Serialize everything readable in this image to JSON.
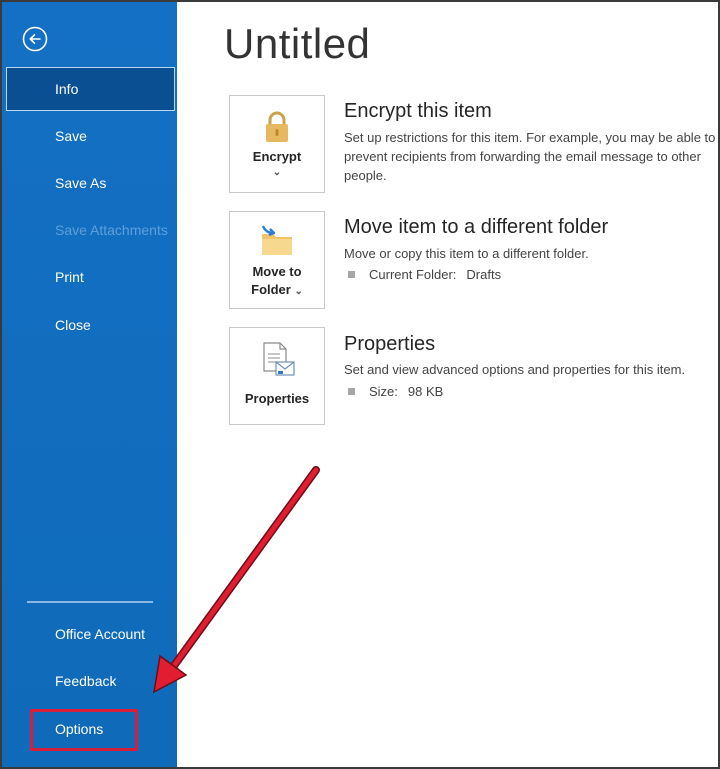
{
  "nav": {
    "items": [
      {
        "label": "Info"
      },
      {
        "label": "Save"
      },
      {
        "label": "Save As"
      },
      {
        "label": "Save Attachments"
      },
      {
        "label": "Print"
      },
      {
        "label": "Close"
      }
    ],
    "bottom_items": [
      {
        "label": "Office Account"
      },
      {
        "label": "Feedback"
      },
      {
        "label": "Options"
      }
    ]
  },
  "page": {
    "title": "Untitled"
  },
  "sections": {
    "encrypt": {
      "tile_label": "Encrypt",
      "tile_chevron": "⌄",
      "title": "Encrypt this item",
      "description": "Set up restrictions for this item. For example, you may be able to prevent recipients from forwarding the email message to other people."
    },
    "move": {
      "tile_label_line1": "Move to",
      "tile_label_line2": "Folder",
      "tile_chevron": "⌄",
      "title": "Move item to a different folder",
      "description": "Move or copy this item to a different folder.",
      "prop_label": "Current Folder:",
      "prop_value": "Drafts"
    },
    "properties": {
      "tile_label": "Properties",
      "title": "Properties",
      "description": "Set and view advanced options and properties for this item.",
      "prop_label": "Size:",
      "prop_value": "98 KB"
    }
  },
  "colors": {
    "sidebar": "#106ebe",
    "active_item": "#0b4f93",
    "highlight": "#d71f3a"
  },
  "icons": {
    "back": "back-arrow-icon",
    "encrypt": "lock-icon",
    "move": "folder-move-icon",
    "properties": "document-properties-icon"
  }
}
